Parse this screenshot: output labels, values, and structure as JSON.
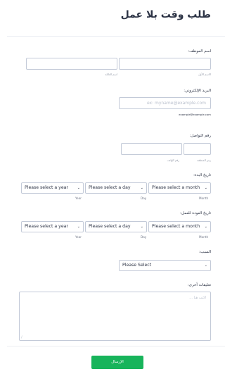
{
  "form": {
    "title": "طلب وقت بلا عمل"
  },
  "employee_name": {
    "label": "اسم الموظف:",
    "first_name_caption": "الاسم الأول",
    "last_name_caption": "اسم العائلة",
    "first_name_value": "",
    "last_name_value": ""
  },
  "email": {
    "label": "البريد الإلكتروني:",
    "placeholder": "ex: myname@example.com",
    "caption": "example@example.com",
    "value": ""
  },
  "phone": {
    "label": "رقم التواصل:",
    "area_code_caption": "رمز المنطقة",
    "phone_caption": "رقم الهاتف",
    "area_value": "",
    "number_value": ""
  },
  "start_date": {
    "label": "تاريخ البدء:",
    "month_placeholder": "Please select a month",
    "day_placeholder": "Please select a day",
    "year_placeholder": "Please select a year",
    "month_caption": "Month",
    "day_caption": "Day",
    "year_caption": "Year"
  },
  "return_date": {
    "label": "تاريخ العودة للعمل:",
    "month_placeholder": "Please select a month",
    "day_placeholder": "Please select a day",
    "year_placeholder": "Please select a year",
    "month_caption": "Month",
    "day_caption": "Day",
    "year_caption": "Year"
  },
  "reason": {
    "label": "السبب:",
    "selected": "Please Select"
  },
  "comments": {
    "label": "تعليقات أخرى:",
    "placeholder": "اكتب هنا ..."
  },
  "submit": {
    "label": "الإرسال"
  },
  "icons": {
    "chevron": "chevron-down-icon",
    "resize": "resize-handle-icon"
  },
  "colors": {
    "accent": "#18b45b",
    "border": "#c3cad8",
    "text": "#2c3345"
  }
}
